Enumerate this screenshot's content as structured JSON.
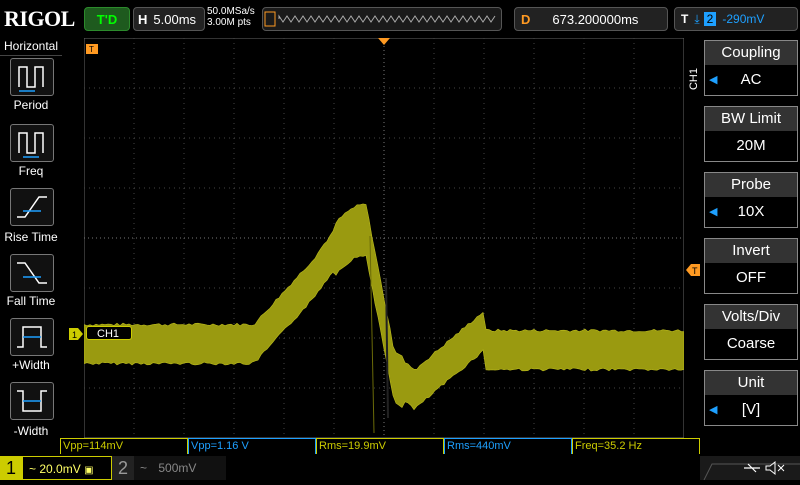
{
  "brand": "RIGOL",
  "topbar": {
    "trigger_status": "T'D",
    "timebase_label": "H",
    "timebase_value": "5.00ms",
    "sample_rate": "50.0MSa/s",
    "memory_depth": "3.00M pts",
    "delay_label": "D",
    "delay_value": "673.200000ms",
    "trigger_label": "T",
    "trigger_source": "2",
    "trigger_level": "-290mV"
  },
  "left_panel": {
    "title": "Horizontal",
    "items": [
      {
        "label": "Period"
      },
      {
        "label": "Freq"
      },
      {
        "label": "Rise Time"
      },
      {
        "label": "Fall Time"
      },
      {
        "label": "+Width"
      },
      {
        "label": "-Width"
      }
    ]
  },
  "channel_marker": "CH1",
  "channel_vertical": "CH1",
  "right_panel": [
    {
      "title": "Coupling",
      "value": "AC",
      "arrow": true
    },
    {
      "title": "BW Limit",
      "value": "20M",
      "arrow": false
    },
    {
      "title": "Probe",
      "value": "10X",
      "arrow": true
    },
    {
      "title": "Invert",
      "value": "OFF",
      "arrow": false
    },
    {
      "title": "Volts/Div",
      "value": "Coarse",
      "arrow": false
    },
    {
      "title": "Unit",
      "value": "[V]",
      "arrow": true
    }
  ],
  "measurements": [
    {
      "text": "Vpp=114mV",
      "color": "#cccc00"
    },
    {
      "text": "Vpp=1.16 V",
      "color": "#1ea0ff"
    },
    {
      "text": "Rms=19.9mV",
      "color": "#cccc00"
    },
    {
      "text": "Rms=440mV",
      "color": "#1ea0ff"
    },
    {
      "text": "Freq=35.2 Hz",
      "color": "#cccc00"
    }
  ],
  "bottombar": {
    "ch1_number": "1",
    "ch1_scale": "20.0mV",
    "ch2_number": "2",
    "ch2_scale": "500mV"
  },
  "colors": {
    "ch1": "#cccc00",
    "ch2": "#1ea0ff",
    "trigger": "#ff9a22",
    "grid": "#555555"
  }
}
